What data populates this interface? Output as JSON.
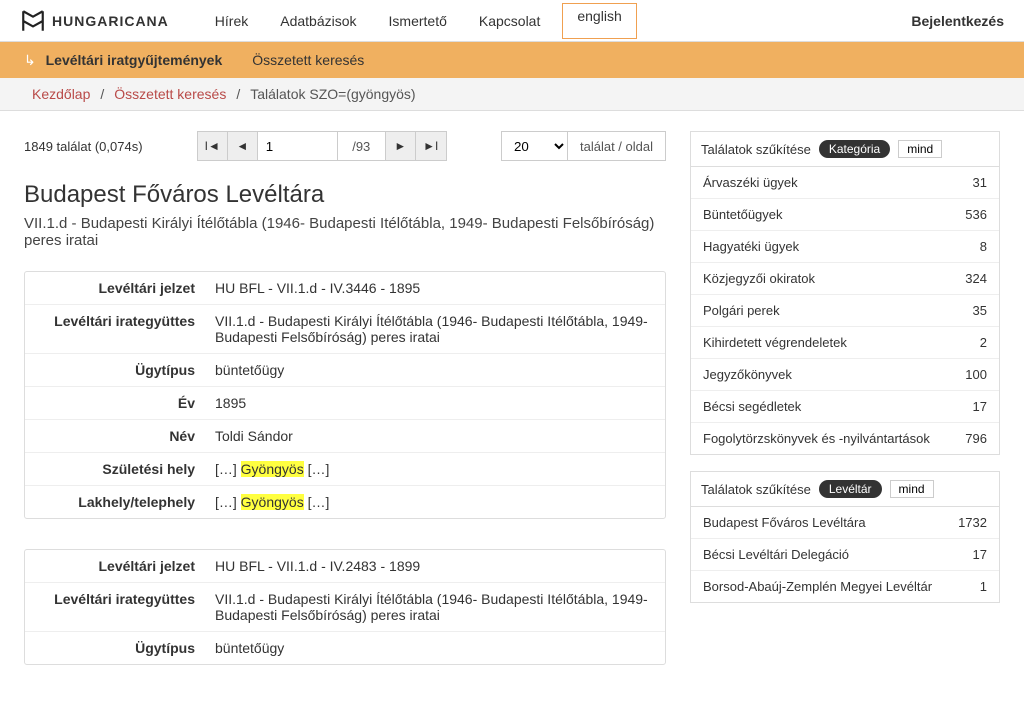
{
  "logo_text": "HUNGARICANA",
  "nav": {
    "hirek": "Hírek",
    "adatbazisok": "Adatbázisok",
    "ismerteto": "Ismertető",
    "kapcsolat": "Kapcsolat",
    "english": "english",
    "login": "Bejelentkezés"
  },
  "subnav": {
    "main": "Levéltári iratgyűjtemények",
    "sub": "Összetett keresés"
  },
  "breadcrumb": {
    "home": "Kezdőlap",
    "search": "Összetett keresés",
    "current": "Találatok SZO=(gyöngyös)"
  },
  "results": {
    "count_text": "1849 találat (0,074s)",
    "page_value": "1",
    "page_total": "/93",
    "per_page_value": "20",
    "per_page_label": "találat / oldal"
  },
  "archive": {
    "title": "Budapest Főváros Levéltára",
    "subtitle": "VII.1.d - Budapesti Királyi Ítélőtábla (1946- Budapesti Itélőtábla, 1949- Budapesti Felsőbíróság) peres iratai"
  },
  "labels": {
    "jelzet": "Levéltári jelzet",
    "irategy": "Levéltári irategyüttes",
    "ugytipus": "Ügytípus",
    "ev": "Év",
    "nev": "Név",
    "szulhely": "Születési hely",
    "lakhely": "Lakhely/telephely"
  },
  "rec1": {
    "jelzet": "HU BFL - VII.1.d - IV.3446 - 1895",
    "irategy": "VII.1.d - Budapesti Királyi Ítélőtábla (1946- Budapesti Itélőtábla, 1949- Budapesti Felsőbíróság) peres iratai",
    "ugytipus": "büntetőügy",
    "ev": "1895",
    "nev": "Toldi Sándor",
    "hl": "Gyöngyös",
    "pre": "[…] ",
    "post": " […]"
  },
  "rec2": {
    "jelzet": "HU BFL - VII.1.d - IV.2483 - 1899",
    "irategy": "VII.1.d - Budapesti Királyi Ítélőtábla (1946- Budapesti Itélőtábla, 1949- Budapesti Felsőbíróság) peres iratai",
    "ugytipus": "büntetőügy"
  },
  "filter": {
    "title": "Találatok szűkítése",
    "pill_cat": "Kategória",
    "pill_arch": "Levéltár",
    "mind": "mind",
    "cats": [
      {
        "name": "Árvaszéki ügyek",
        "n": "31"
      },
      {
        "name": "Büntetőügyek",
        "n": "536"
      },
      {
        "name": "Hagyatéki ügyek",
        "n": "8"
      },
      {
        "name": "Közjegyzői okiratok",
        "n": "324"
      },
      {
        "name": "Polgári perek",
        "n": "35"
      },
      {
        "name": "Kihirdetett végrendeletek",
        "n": "2"
      },
      {
        "name": "Jegyzőkönyvek",
        "n": "100"
      },
      {
        "name": "Bécsi segédletek",
        "n": "17"
      },
      {
        "name": "Fogolytörzskönyvek és -nyilvántartások",
        "n": "796"
      }
    ],
    "archs": [
      {
        "name": "Budapest Főváros Levéltára",
        "n": "1732"
      },
      {
        "name": "Bécsi Levéltári Delegáció",
        "n": "17"
      },
      {
        "name": "Borsod-Abaúj-Zemplén Megyei Levéltár",
        "n": "1"
      }
    ]
  }
}
